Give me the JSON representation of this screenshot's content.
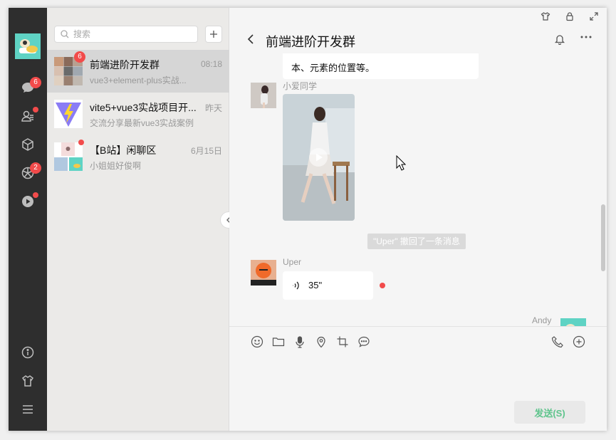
{
  "sidebar": {
    "badges": {
      "chats": "6",
      "moments": "2"
    }
  },
  "search": {
    "placeholder": "搜索"
  },
  "conversations": [
    {
      "name": "前端进阶开发群",
      "time": "08:18",
      "preview": "vue3+element-plus实战...",
      "badge": "6"
    },
    {
      "name": "vite5+vue3实战项目开...",
      "time": "昨天",
      "preview": "交流分享最新vue3实战案例"
    },
    {
      "name": "【B站】闲聊区",
      "time": "6月15日",
      "preview": "小姐姐好俊啊"
    }
  ],
  "chat": {
    "title": "前端进阶开发群",
    "messages": {
      "m0_text": "本、元素的位置等。",
      "m1_sender": "小爱同学",
      "recall_notice": "\"Uper\" 撤回了一条消息",
      "m2_sender": "Uper",
      "m2_voice": "35\"",
      "m3_sender": "Andy"
    },
    "send_label": "发送(S)"
  },
  "colors": {
    "rail_bg": "#2e2e2e",
    "badge": "#f24b4b",
    "send_text": "#5ec48c"
  }
}
